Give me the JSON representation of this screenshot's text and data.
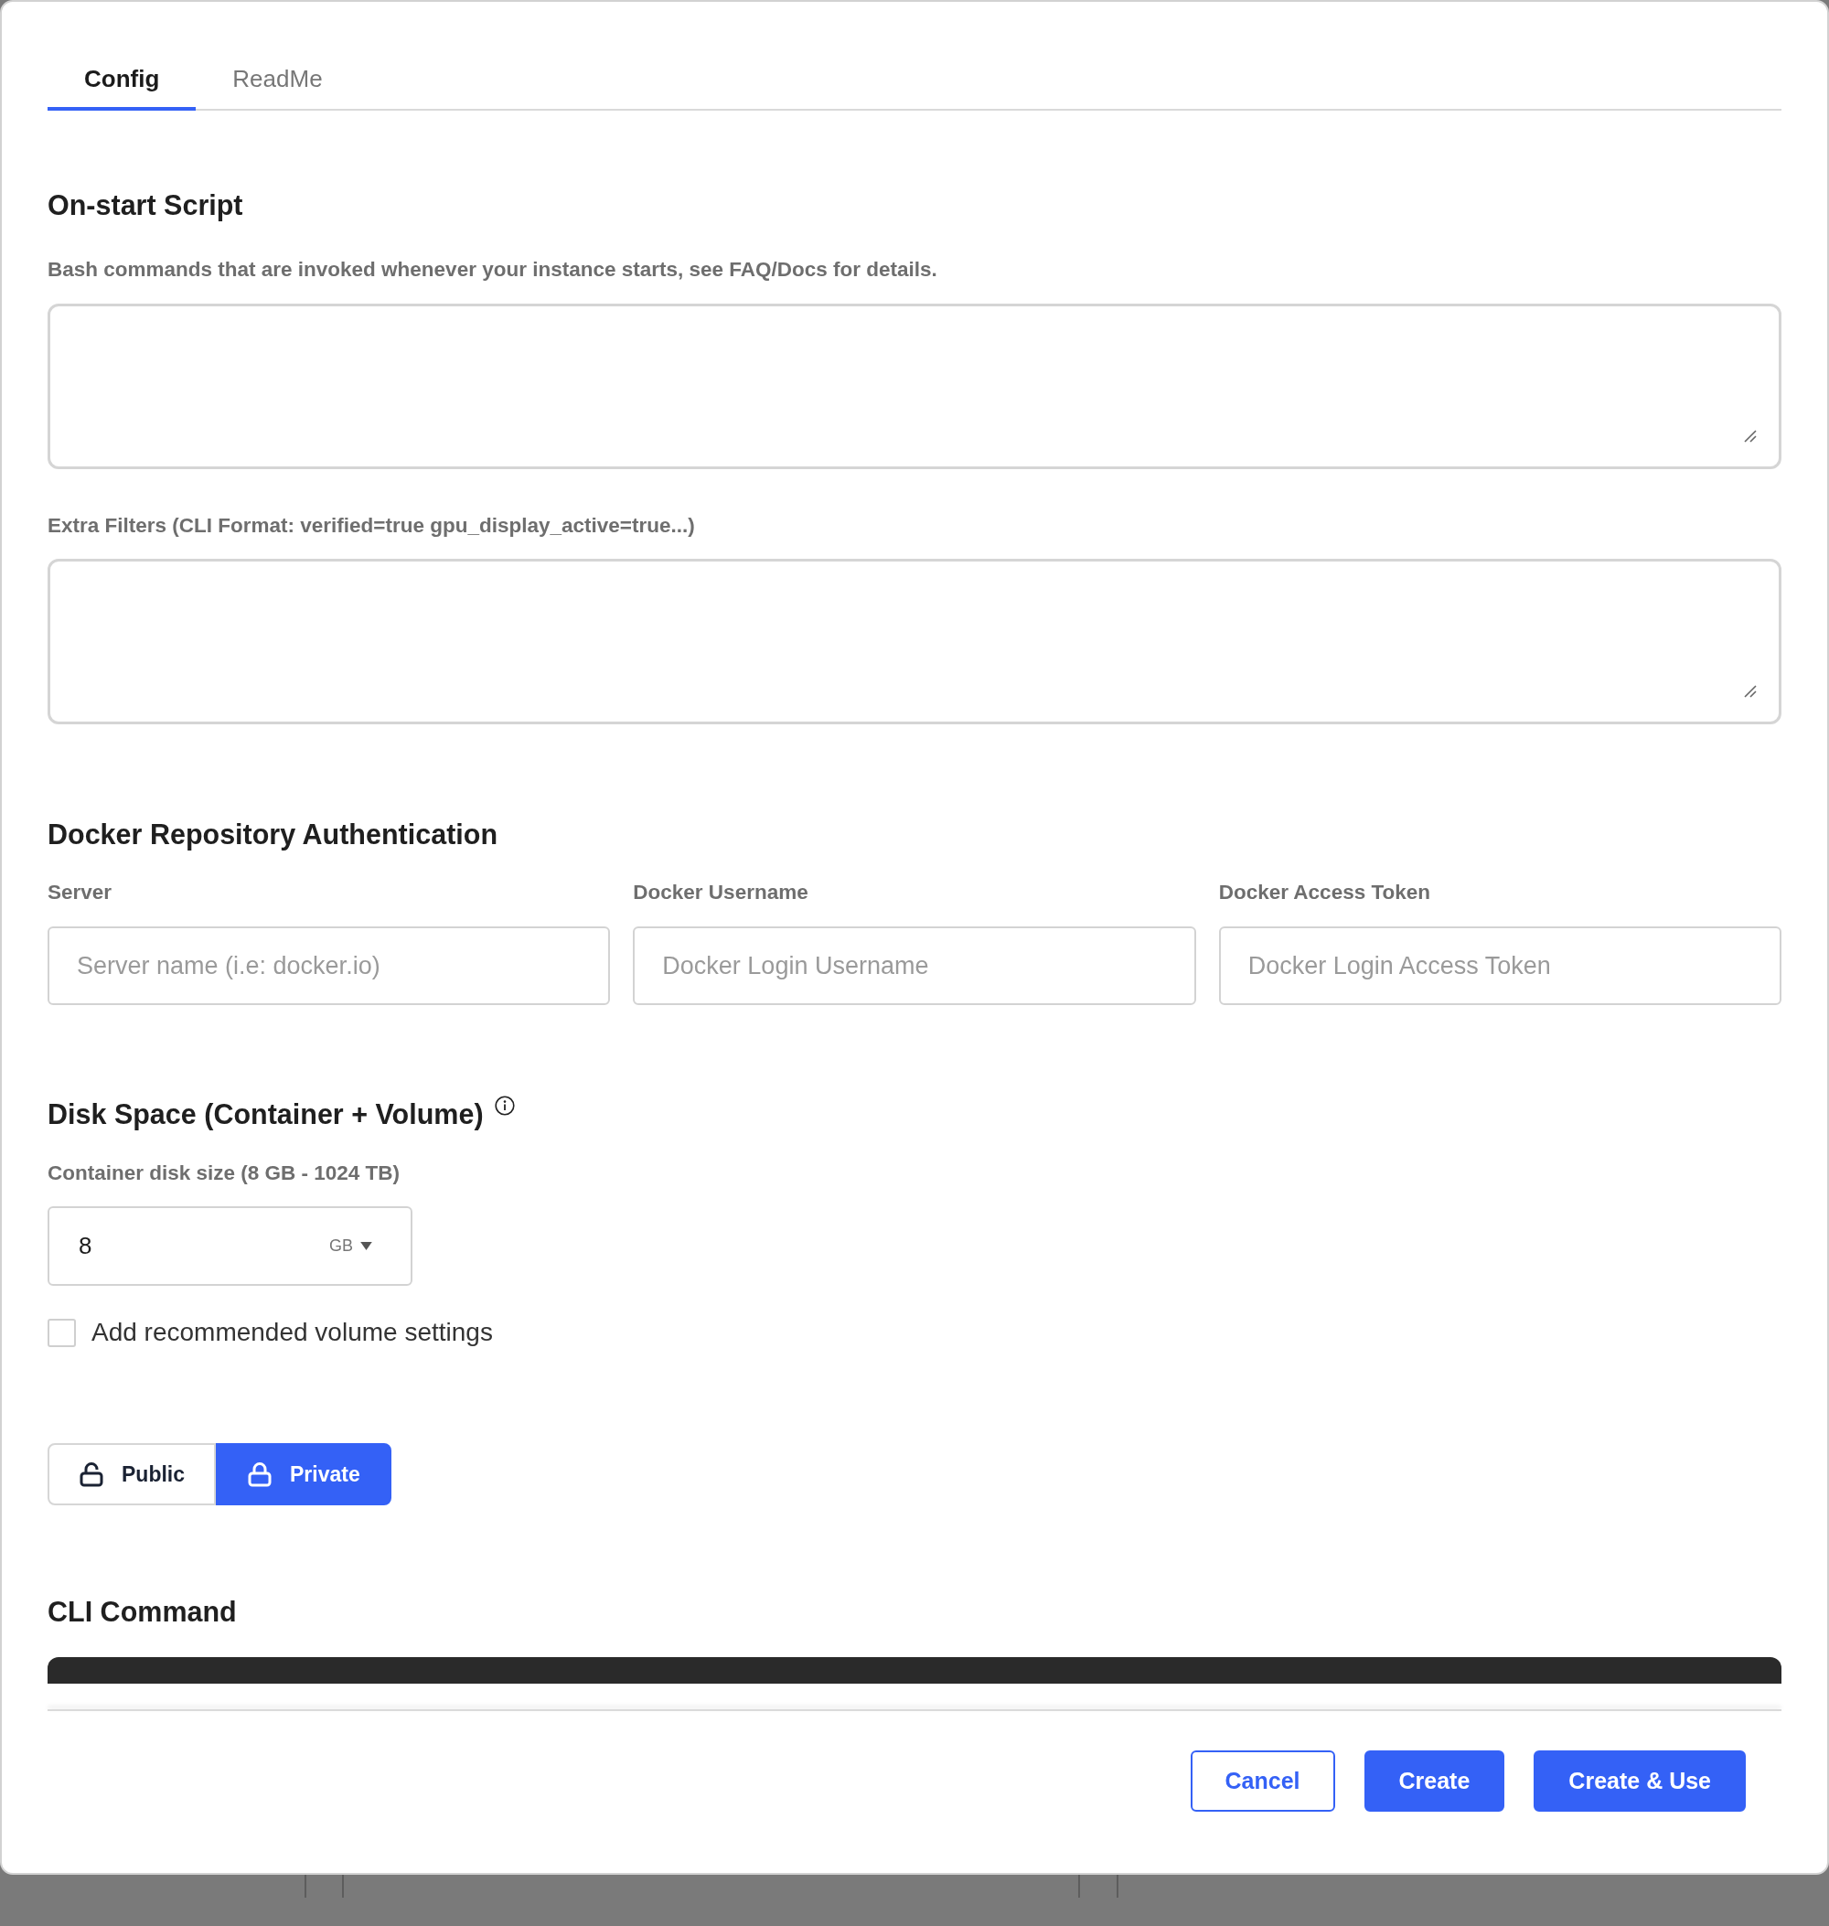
{
  "tabs": [
    {
      "label": "Config",
      "selected": true
    },
    {
      "label": "ReadMe",
      "selected": false
    }
  ],
  "onstart_script": {
    "title": "On-start Script",
    "description": "Bash commands that are invoked whenever your instance starts, see FAQ/Docs for details."
  },
  "extra_filters": {
    "label": "Extra Filters (CLI Format: verified=true gpu_display_active=true...)"
  },
  "docker_auth": {
    "title": "Docker Repository Authentication",
    "fields": [
      {
        "label": "Server",
        "placeholder": "Server name (i.e: docker.io)"
      },
      {
        "label": "Docker Username",
        "placeholder": "Docker Login Username"
      },
      {
        "label": "Docker Access Token",
        "placeholder": "Docker Login Access Token"
      }
    ]
  },
  "disk_space": {
    "title": "Disk Space (Container + Volume)",
    "size_label": "Container disk size (8 GB - 1024 TB)",
    "size_value": "8",
    "unit": "GB",
    "recommended_volume": {
      "label": "Add recommended volume settings",
      "checked": false
    }
  },
  "visibility": [
    {
      "label": "Public",
      "kind": "unlocked",
      "selected": false
    },
    {
      "label": "Private",
      "kind": "locked",
      "selected": true
    }
  ],
  "cli_command": {
    "title": "CLI Command"
  },
  "footer_buttons": [
    {
      "label": "Cancel",
      "kind": "secondary"
    },
    {
      "label": "Create",
      "kind": "primary"
    },
    {
      "label": "Create & Use",
      "kind": "primary"
    }
  ]
}
